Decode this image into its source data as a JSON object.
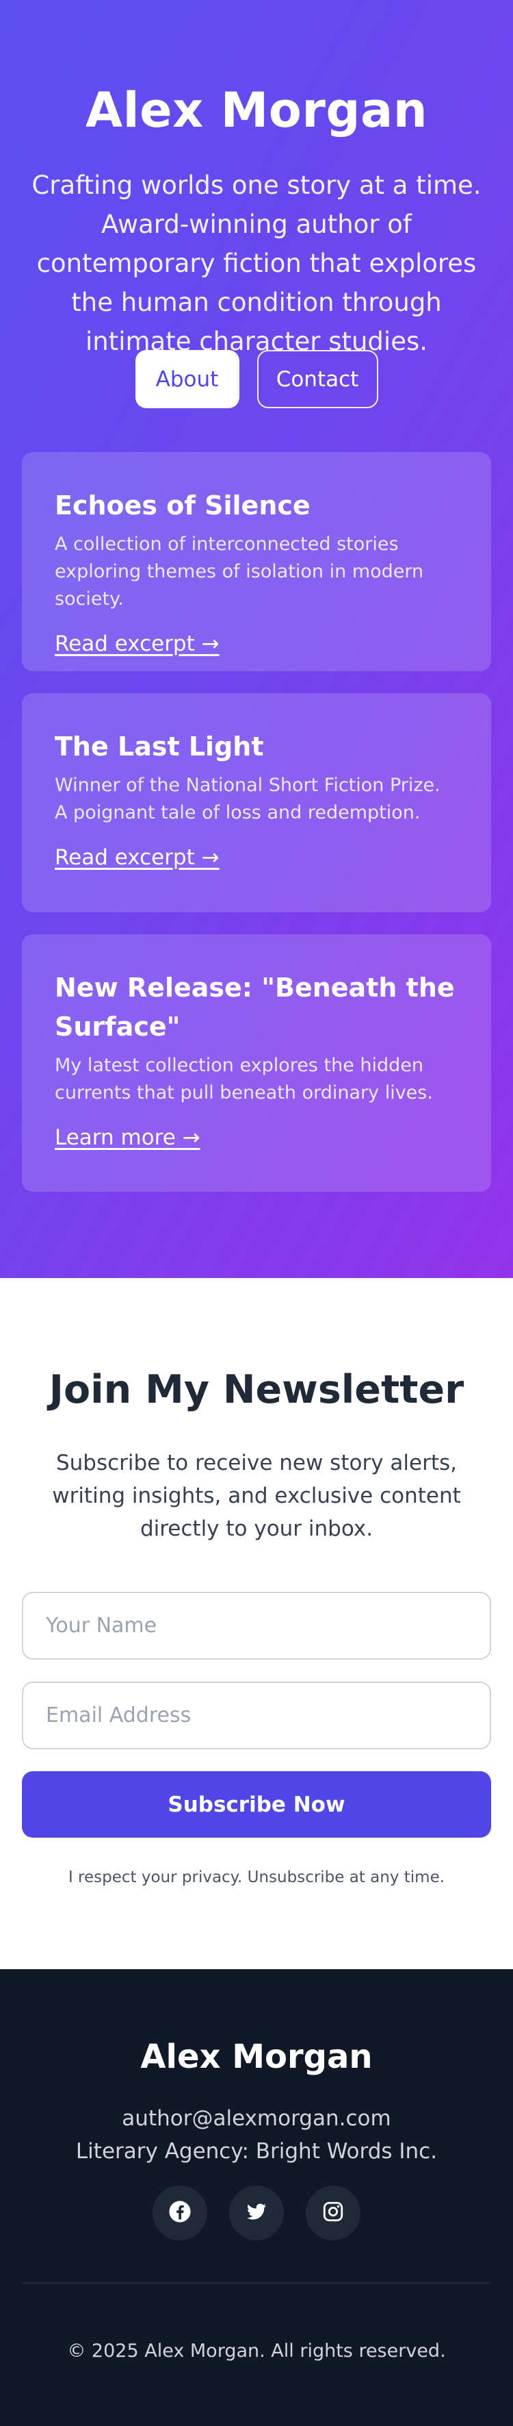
{
  "hero": {
    "title": "Alex Morgan",
    "tagline": "Crafting worlds one story at a time. Award-winning author of contemporary fiction that explores the human condition through intimate character studies.",
    "about_label": "About",
    "contact_label": "Contact"
  },
  "cards": [
    {
      "title": "Echoes of Silence",
      "description": "A collection of interconnected stories exploring themes of isolation in modern society.",
      "link": "Read excerpt →"
    },
    {
      "title": "The Last Light",
      "description": "Winner of the National Short Fiction Prize. A poignant tale of loss and redemption.",
      "link": "Read excerpt →"
    },
    {
      "title": "New Release: \"Beneath the Surface\"",
      "description": "My latest collection explores the hidden currents that pull beneath ordinary lives.",
      "link": "Learn more →"
    }
  ],
  "newsletter": {
    "title": "Join My Newsletter",
    "description": "Subscribe to receive new story alerts, writing insights, and exclusive content directly to your inbox.",
    "name_placeholder": "Your Name",
    "name_value": "",
    "email_placeholder": "Email Address",
    "email_value": "",
    "submit_label": "Subscribe Now",
    "privacy": "I respect your privacy. Unsubscribe at any time."
  },
  "footer": {
    "name": "Alex Morgan",
    "email": "author@alexmorgan.com",
    "agency": "Literary Agency: Bright Words Inc.",
    "socials": [
      {
        "icon": "facebook-icon"
      },
      {
        "icon": "twitter-icon"
      },
      {
        "icon": "instagram-icon"
      }
    ],
    "copyright": "© 2025 Alex Morgan. All rights reserved."
  },
  "colors": {
    "gradient_start": "#5b4ff0",
    "gradient_end": "#9333ea",
    "accent": "#4f46e5",
    "footer_bg": "#111827",
    "heading_dark": "#1f2937"
  }
}
